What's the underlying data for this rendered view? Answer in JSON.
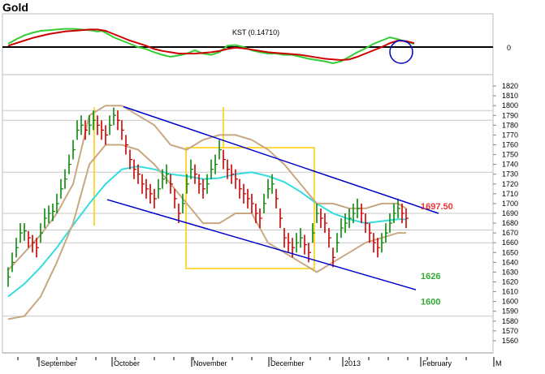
{
  "page": {
    "title": "Gold"
  },
  "chart_data": [
    {
      "type": "line",
      "panel": "indicator",
      "title": "KST (0.14710)",
      "zero_label": "0",
      "zero_value": 0,
      "ylim": [
        -0.4,
        0.45
      ],
      "series": [
        {
          "color": "#33cc33",
          "x": [
            0,
            10,
            20,
            30,
            40,
            50,
            60,
            70,
            80,
            90,
            100,
            110,
            115,
            120,
            130,
            140,
            150,
            160,
            170,
            180,
            190,
            200,
            210,
            220,
            230,
            240,
            250,
            260,
            270,
            280,
            290,
            300,
            310,
            320,
            330,
            340,
            350,
            360,
            370,
            380,
            390,
            400,
            410,
            420,
            430,
            440,
            450,
            460,
            470,
            480,
            490,
            500
          ],
          "y": [
            0.05,
            0.12,
            0.18,
            0.22,
            0.25,
            0.26,
            0.27,
            0.28,
            0.28,
            0.27,
            0.26,
            0.24,
            0.25,
            0.22,
            0.15,
            0.1,
            0.05,
            0.0,
            -0.03,
            -0.08,
            -0.12,
            -0.15,
            -0.13,
            -0.1,
            -0.05,
            -0.1,
            -0.12,
            -0.08,
            0.02,
            0.03,
            0.0,
            -0.05,
            -0.08,
            -0.1,
            -0.1,
            -0.12,
            -0.12,
            -0.15,
            -0.18,
            -0.2,
            -0.22,
            -0.25,
            -0.22,
            -0.15,
            -0.08,
            -0.02,
            0.05,
            0.1,
            0.15,
            0.12,
            0.08,
            0.05
          ]
        },
        {
          "color": "#cc0000",
          "x": [
            0,
            10,
            20,
            30,
            40,
            50,
            60,
            70,
            80,
            90,
            100,
            110,
            120,
            130,
            140,
            150,
            160,
            170,
            180,
            190,
            200,
            210,
            220,
            230,
            240,
            250,
            260,
            270,
            280,
            290,
            300,
            310,
            320,
            330,
            340,
            350,
            360,
            370,
            380,
            390,
            400,
            410,
            420,
            430,
            440,
            450,
            460,
            470,
            480,
            490,
            500
          ],
          "y": [
            0.02,
            0.06,
            0.1,
            0.14,
            0.17,
            0.2,
            0.22,
            0.24,
            0.25,
            0.26,
            0.27,
            0.27,
            0.25,
            0.2,
            0.15,
            0.1,
            0.06,
            0.02,
            -0.03,
            -0.06,
            -0.08,
            -0.1,
            -0.1,
            -0.1,
            -0.09,
            -0.08,
            -0.06,
            -0.03,
            -0.01,
            -0.02,
            -0.04,
            -0.06,
            -0.08,
            -0.09,
            -0.1,
            -0.11,
            -0.12,
            -0.14,
            -0.16,
            -0.18,
            -0.19,
            -0.2,
            -0.19,
            -0.15,
            -0.1,
            -0.05,
            0.0,
            0.06,
            0.1,
            0.09,
            0.06
          ]
        }
      ]
    },
    {
      "type": "line",
      "panel": "price",
      "title": "",
      "ylim": [
        1550,
        1825
      ],
      "yticks": [
        1560,
        1570,
        1580,
        1590,
        1600,
        1610,
        1620,
        1630,
        1640,
        1650,
        1660,
        1670,
        1680,
        1690,
        1700,
        1710,
        1720,
        1730,
        1740,
        1750,
        1760,
        1770,
        1780,
        1790,
        1800,
        1810,
        1820
      ],
      "x_labels": [
        "September",
        "October",
        "November",
        "December",
        "2013",
        "February",
        "M"
      ],
      "annotations": [
        {
          "text": "1697.50",
          "value": 1697.5,
          "color": "#e8343a"
        },
        {
          "text": "1626",
          "value": 1626,
          "color": "#33aa33"
        },
        {
          "text": "1600",
          "value": 1600,
          "color": "#33aa33"
        }
      ],
      "horizontal_lines": [
        1795,
        1785,
        1732,
        1690,
        1673,
        1660,
        1585
      ],
      "price_bars": {
        "x": [
          0,
          5,
          10,
          15,
          20,
          25,
          30,
          35,
          40,
          45,
          50,
          55,
          60,
          65,
          70,
          75,
          80,
          85,
          90,
          95,
          100,
          105,
          110,
          115,
          120,
          125,
          130,
          135,
          140,
          145,
          150,
          155,
          160,
          165,
          170,
          175,
          180,
          185,
          190,
          195,
          200,
          205,
          210,
          215,
          220,
          225,
          230,
          235,
          240,
          245,
          250,
          255,
          260,
          265,
          270,
          275,
          280,
          285,
          290,
          295,
          300,
          305,
          310,
          315,
          320,
          325,
          330,
          335,
          340,
          345,
          350,
          355,
          360,
          365,
          370,
          375,
          380,
          385,
          390,
          395,
          400,
          405,
          410,
          415,
          420,
          425,
          430,
          435,
          440,
          445,
          450,
          455,
          460,
          465,
          470,
          475,
          480,
          485,
          490
        ],
        "close": [
          1625,
          1640,
          1655,
          1670,
          1672,
          1665,
          1660,
          1655,
          1670,
          1685,
          1690,
          1692,
          1700,
          1715,
          1725,
          1740,
          1755,
          1775,
          1780,
          1775,
          1780,
          1785,
          1780,
          1775,
          1770,
          1780,
          1790,
          1785,
          1775,
          1760,
          1745,
          1735,
          1730,
          1720,
          1715,
          1710,
          1705,
          1715,
          1725,
          1730,
          1720,
          1705,
          1690,
          1700,
          1720,
          1735,
          1730,
          1720,
          1715,
          1720,
          1735,
          1740,
          1755,
          1745,
          1735,
          1730,
          1725,
          1715,
          1710,
          1705,
          1700,
          1690,
          1685,
          1700,
          1715,
          1720,
          1705,
          1685,
          1665,
          1660,
          1655,
          1660,
          1665,
          1658,
          1650,
          1670,
          1690,
          1685,
          1680,
          1665,
          1645,
          1660,
          1675,
          1680,
          1685,
          1690,
          1695,
          1690,
          1680,
          1670,
          1660,
          1655,
          1660,
          1670,
          1680,
          1690,
          1695,
          1690,
          1685
        ],
        "high": [
          1635,
          1650,
          1665,
          1680,
          1680,
          1672,
          1668,
          1665,
          1680,
          1695,
          1698,
          1700,
          1710,
          1725,
          1735,
          1750,
          1765,
          1785,
          1790,
          1785,
          1790,
          1795,
          1790,
          1785,
          1780,
          1790,
          1798,
          1795,
          1785,
          1770,
          1755,
          1745,
          1740,
          1730,
          1725,
          1720,
          1715,
          1725,
          1735,
          1740,
          1730,
          1715,
          1700,
          1710,
          1730,
          1745,
          1740,
          1730,
          1725,
          1730,
          1745,
          1750,
          1765,
          1755,
          1745,
          1740,
          1735,
          1725,
          1720,
          1715,
          1710,
          1700,
          1695,
          1710,
          1725,
          1730,
          1715,
          1695,
          1675,
          1670,
          1665,
          1670,
          1675,
          1668,
          1660,
          1680,
          1700,
          1695,
          1690,
          1675,
          1655,
          1670,
          1685,
          1690,
          1695,
          1700,
          1705,
          1700,
          1690,
          1680,
          1670,
          1665,
          1670,
          1680,
          1690,
          1700,
          1705,
          1700,
          1695
        ],
        "low": [
          1615,
          1630,
          1645,
          1660,
          1662,
          1655,
          1650,
          1645,
          1660,
          1675,
          1680,
          1682,
          1690,
          1705,
          1715,
          1730,
          1745,
          1765,
          1770,
          1765,
          1770,
          1775,
          1770,
          1765,
          1760,
          1770,
          1780,
          1775,
          1765,
          1750,
          1735,
          1725,
          1720,
          1710,
          1705,
          1700,
          1695,
          1705,
          1715,
          1720,
          1710,
          1695,
          1680,
          1690,
          1710,
          1725,
          1720,
          1710,
          1705,
          1710,
          1725,
          1730,
          1745,
          1735,
          1725,
          1720,
          1715,
          1705,
          1700,
          1695,
          1690,
          1680,
          1675,
          1690,
          1705,
          1710,
          1695,
          1675,
          1655,
          1650,
          1645,
          1650,
          1655,
          1648,
          1640,
          1660,
          1680,
          1675,
          1670,
          1655,
          1635,
          1650,
          1665,
          1670,
          1675,
          1680,
          1685,
          1680,
          1670,
          1660,
          1650,
          1645,
          1650,
          1660,
          1670,
          1680,
          1685,
          1680,
          1675
        ]
      },
      "series": [
        {
          "color": "#33dddd",
          "x": [
            0,
            20,
            40,
            60,
            80,
            100,
            120,
            140,
            160,
            180,
            200,
            220,
            240,
            260,
            280,
            300,
            320,
            340,
            360,
            380,
            400,
            420,
            440,
            460,
            480,
            490
          ],
          "y": [
            1605,
            1618,
            1635,
            1655,
            1678,
            1700,
            1720,
            1735,
            1738,
            1735,
            1730,
            1728,
            1725,
            1726,
            1730,
            1732,
            1728,
            1722,
            1712,
            1700,
            1690,
            1684,
            1680,
            1682,
            1684,
            1684
          ]
        },
        {
          "color": "#c8a882",
          "x": [
            0,
            20,
            40,
            60,
            80,
            100,
            120,
            140,
            160,
            180,
            200,
            220,
            240,
            260,
            280,
            300,
            320,
            340,
            360,
            380,
            400,
            420,
            440,
            460,
            480,
            490
          ],
          "y": [
            1582,
            1585,
            1605,
            1640,
            1680,
            1740,
            1760,
            1760,
            1755,
            1740,
            1720,
            1700,
            1680,
            1680,
            1690,
            1690,
            1660,
            1650,
            1640,
            1630,
            1640,
            1650,
            1660,
            1665,
            1670,
            1670
          ]
        },
        {
          "color": "#c8a882",
          "x": [
            0,
            20,
            40,
            60,
            80,
            100,
            120,
            140,
            160,
            180,
            200,
            220,
            240,
            260,
            280,
            300,
            320,
            340,
            360,
            380,
            400,
            420,
            440,
            460,
            480,
            490
          ],
          "y": [
            1632,
            1650,
            1668,
            1690,
            1720,
            1790,
            1800,
            1800,
            1790,
            1780,
            1760,
            1755,
            1765,
            1770,
            1770,
            1765,
            1755,
            1740,
            1720,
            1700,
            1700,
            1695,
            1695,
            1700,
            1700,
            1695
          ]
        }
      ]
    }
  ]
}
